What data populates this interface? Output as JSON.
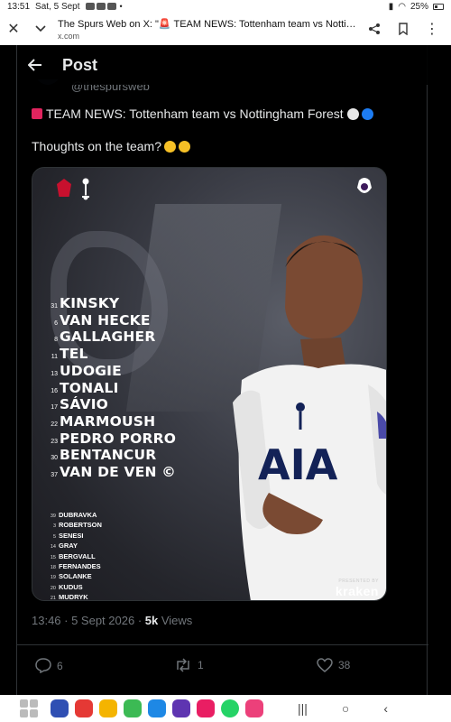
{
  "status_bar": {
    "time": "13:51",
    "date": "Sat, 5 Sept",
    "dot": "•",
    "battery": "25%"
  },
  "browser": {
    "page_title": "The Spurs Web on X: \"🚨 TEAM NEWS: Tottenham team vs Nottingham ...",
    "url": "x.com",
    "icons": [
      "close-icon",
      "chevron-down-icon",
      "share-icon",
      "bookmark-icon",
      "more-icon"
    ]
  },
  "header": {
    "title": "Post"
  },
  "tweet": {
    "handle": "@thespursweb",
    "text_line1": "TEAM NEWS: Tottenham team vs Nottingham Forest",
    "text_line2": "Thoughts on the team?"
  },
  "graphic": {
    "starters": [
      {
        "num": "31",
        "name": "KINSKY"
      },
      {
        "num": "6",
        "name": "VAN HECKE"
      },
      {
        "num": "8",
        "name": "GALLAGHER"
      },
      {
        "num": "11",
        "name": "TEL"
      },
      {
        "num": "13",
        "name": "UDOGIE"
      },
      {
        "num": "16",
        "name": "TONALI"
      },
      {
        "num": "17",
        "name": "SÁVIO"
      },
      {
        "num": "22",
        "name": "MARMOUSH"
      },
      {
        "num": "23",
        "name": "PEDRO PORRO"
      },
      {
        "num": "30",
        "name": "BENTANCUR"
      },
      {
        "num": "37",
        "name": "VAN DE VEN ©"
      }
    ],
    "subs": [
      {
        "num": "39",
        "name": "DUBRAVKA"
      },
      {
        "num": "3",
        "name": "ROBERTSON"
      },
      {
        "num": "5",
        "name": "SENESI"
      },
      {
        "num": "14",
        "name": "GRAY"
      },
      {
        "num": "15",
        "name": "BERGVALL"
      },
      {
        "num": "18",
        "name": "FERNANDES"
      },
      {
        "num": "19",
        "name": "SOLANKE"
      },
      {
        "num": "20",
        "name": "KUDUS"
      },
      {
        "num": "21",
        "name": "MUDRYK"
      }
    ],
    "shirt_text": "AIA",
    "presented_by": "PRESENTED BY",
    "sponsor": "kraken"
  },
  "meta": {
    "time_date": "13:46 · 5 Sept 2026 · ",
    "views_count": "5k",
    "views_label": " Views"
  },
  "actions": {
    "replies": "6",
    "reposts": "1",
    "likes": "38"
  },
  "colors": {
    "background": "#000000",
    "text": "#e7e9ea",
    "muted": "#71767b",
    "border": "#2f3336"
  }
}
